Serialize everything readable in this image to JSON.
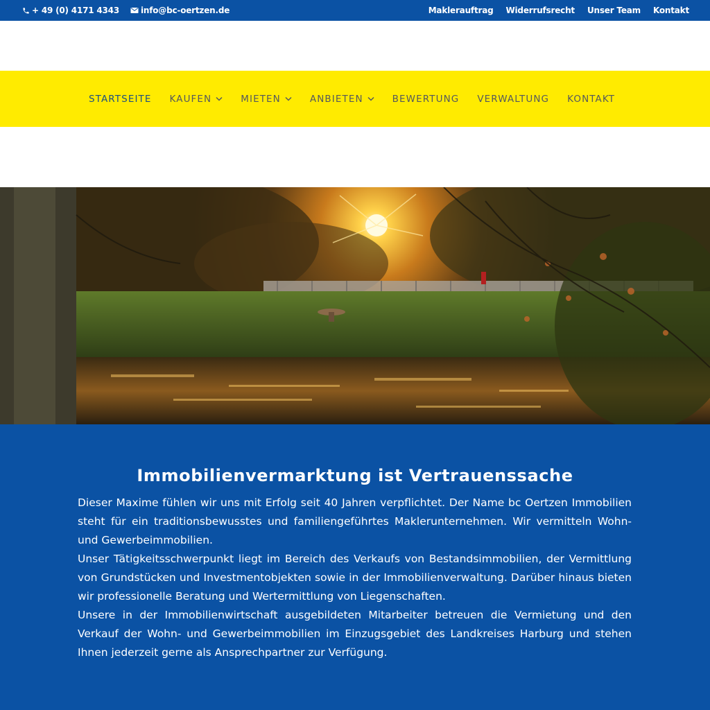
{
  "topbar": {
    "phone": "+ 49 (0) 4171 4343",
    "email": "info@bc-oertzen.de",
    "links": [
      "Maklerauftrag",
      "Widerrufsrecht",
      "Unser Team",
      "Kontakt"
    ]
  },
  "nav": {
    "items": [
      {
        "label": "STARTSEITE",
        "active": true,
        "dropdown": false
      },
      {
        "label": "KAUFEN",
        "active": false,
        "dropdown": true
      },
      {
        "label": "MIETEN",
        "active": false,
        "dropdown": true
      },
      {
        "label": "ANBIETEN",
        "active": false,
        "dropdown": true
      },
      {
        "label": "BEWERTUNG",
        "active": false,
        "dropdown": false
      },
      {
        "label": "VERWALTUNG",
        "active": false,
        "dropdown": false
      },
      {
        "label": "KONTAKT",
        "active": false,
        "dropdown": false
      }
    ]
  },
  "main": {
    "heading": "Immobilienvermarktung ist Vertrauenssache",
    "paragraphs": [
      "Dieser Maxime fühlen wir uns mit Erfolg seit 40 Jahren verpflichtet. Der Name bc Oertzen Immobilien steht für ein traditionsbewusstes und familiengeführtes Maklerunternehmen. Wir vermitteln Wohn- und Gewerbeimmobilien.",
      "Unser Tätigkeitsschwerpunkt liegt im Bereich des Verkaufs von Bestandsimmobilien, der Vermittlung von Grundstücken und Investmentobjekten sowie in der Immobilienverwaltung. Darüber hinaus bieten wir professionelle Beratung und Wertermittlung von Liegenschaften.",
      "Unsere in der Immobilienwirtschaft ausgebildeten Mitarbeiter betreuen die Vermietung und den Verkauf der Wohn- und Gewerbeimmobilien im Einzugsgebiet des Landkreises Harburg und stehen Ihnen jederzeit gerne als Ansprechpartner zur Verfügung."
    ]
  },
  "colors": {
    "primary_blue": "#0b52a4",
    "nav_yellow": "#ffeb00",
    "nav_text": "#55595c",
    "nav_active": "#1a4f80"
  },
  "icons": {
    "phone": "phone-icon",
    "email": "envelope-icon",
    "dropdown": "chevron-down-icon"
  }
}
